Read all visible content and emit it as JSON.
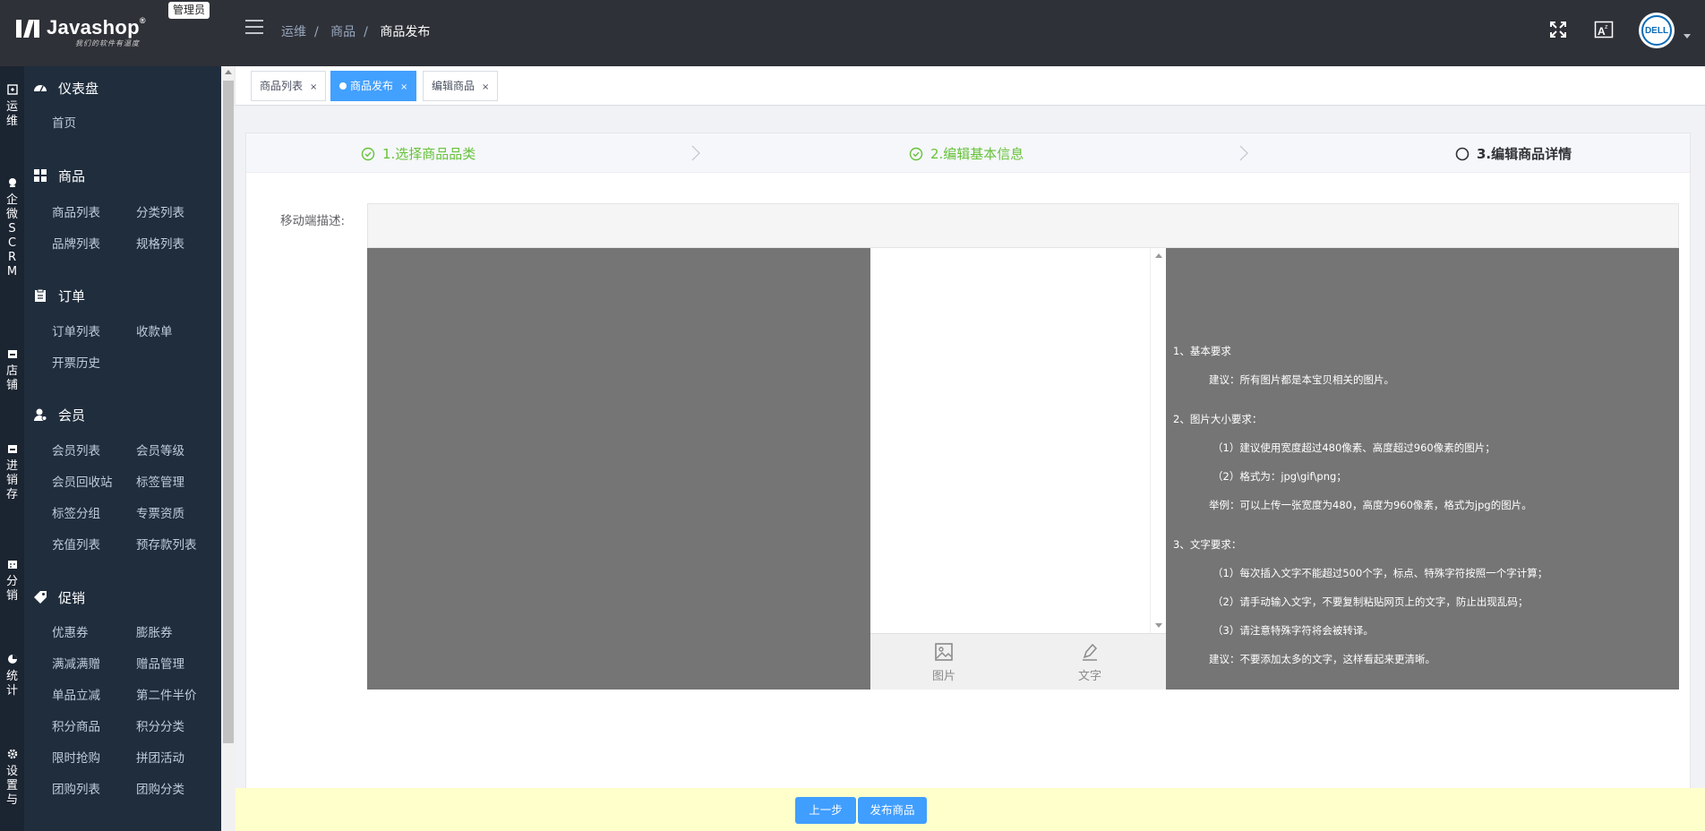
{
  "header": {
    "logo_text": "Javashop",
    "logo_reg": "®",
    "logo_slogan": "我们的软件有温度",
    "role_badge": "管理员",
    "breadcrumb": [
      "运维",
      "商品",
      "商品发布"
    ],
    "avatar_text": "DELL"
  },
  "rail": [
    "运维",
    "企微SCRM",
    "店铺",
    "进销存",
    "分销",
    "统计",
    "设置与"
  ],
  "sidebar": {
    "groups": [
      {
        "title": "仪表盘",
        "icon": "dashboard-icon",
        "items": [
          "首页"
        ]
      },
      {
        "title": "商品",
        "icon": "grid-icon",
        "items": [
          "商品列表",
          "分类列表",
          "品牌列表",
          "规格列表"
        ]
      },
      {
        "title": "订单",
        "icon": "clipboard-icon",
        "items": [
          "订单列表",
          "收款单",
          "开票历史"
        ]
      },
      {
        "title": "会员",
        "icon": "user-icon",
        "items": [
          "会员列表",
          "会员等级",
          "会员回收站",
          "标签管理",
          "标签分组",
          "专票资质",
          "充值列表",
          "预存款列表"
        ]
      },
      {
        "title": "促销",
        "icon": "tag-icon",
        "items": [
          "优惠券",
          "膨胀券",
          "满减满赠",
          "赠品管理",
          "单品立减",
          "第二件半价",
          "积分商品",
          "积分分类",
          "限时抢购",
          "拼团活动",
          "团购列表",
          "团购分类"
        ]
      }
    ]
  },
  "tags": [
    {
      "label": "商品列表",
      "close": "×",
      "active": false
    },
    {
      "label": "商品发布",
      "close": "×",
      "active": true
    },
    {
      "label": "编辑商品",
      "close": "×",
      "active": false
    }
  ],
  "steps": [
    {
      "label": "1.选择商品品类",
      "status": "done"
    },
    {
      "label": "2.编辑基本信息",
      "status": "done"
    },
    {
      "label": "3.编辑商品详情",
      "status": "current"
    }
  ],
  "editor": {
    "label": "移动端描述:",
    "tools": [
      {
        "label": "图片",
        "icon": "image-icon"
      },
      {
        "label": "文字",
        "icon": "pen-icon"
      }
    ],
    "rules": [
      "1、基本要求",
      "建议：所有图片都是本宝贝相关的图片。",
      "2、图片大小要求：",
      "（1）建议使用宽度超过480像素、高度超过960像素的图片；",
      "（2）格式为：jpg\\gif\\png；",
      "举例：可以上传一张宽度为480，高度为960像素，格式为jpg的图片。",
      "3、文字要求：",
      "（1）每次插入文字不能超过500个字，标点、特殊字符按照一个字计算；",
      "（2）请手动输入文字，不要复制粘贴网页上的文字，防止出现乱码；",
      "（3）请注意特殊字符将会被转译。",
      "建议：不要添加太多的文字，这样看起来更清晰。"
    ]
  },
  "footer": {
    "prev_label": "上一步",
    "publish_label": "发布商品"
  },
  "colors": {
    "primary": "#409eff",
    "success": "#67c23a",
    "sidebar": "#1f2d3d",
    "header": "#2f3138",
    "footer": "#ffffcc"
  }
}
